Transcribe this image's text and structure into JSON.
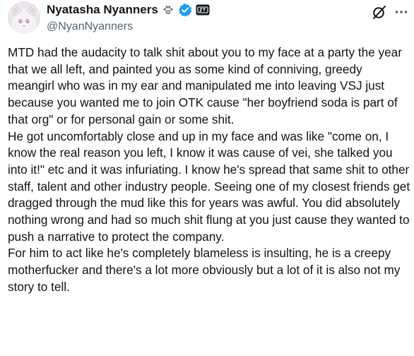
{
  "author": {
    "display_name": "Nyatasha Nyanners",
    "handle": "@NyanNyanners",
    "badges": [
      "paw-print-icon",
      "verified-badge-icon",
      "affiliate-badge-icon"
    ]
  },
  "actions": {
    "grok_icon": "grok-icon",
    "more_icon": "more-options-icon"
  },
  "colors": {
    "verified": "#1d9bf0",
    "text": "#0f1419",
    "secondary": "#536471"
  },
  "tweet": {
    "paragraphs": [
      "MTD had the audacity to talk shit about you to my face at a party the year that we all left, and painted you as some kind of conniving, greedy meangirl who was in my ear and manipulated me into leaving VSJ just because you wanted me to join OTK cause \"her boyfriend soda is part of that org\" or for personal gain or some shit.",
      "He got uncomfortably close and up in my face and was like \"come on, I know the real reason you left, I know it was cause of vei, she talked you into it!\" etc and it was infuriating. I know he's spread that same shit to other staff, talent and other industry people. Seeing one of my closest friends get dragged through the mud like this for years was awful. You did absolutely nothing wrong and had so much shit flung at you just cause they wanted to push a narrative to protect the company.",
      "For him to act like he's completely blameless is insulting, he is a creepy motherfucker and there's a lot more obviously but a lot of it is also not my story to tell."
    ]
  }
}
